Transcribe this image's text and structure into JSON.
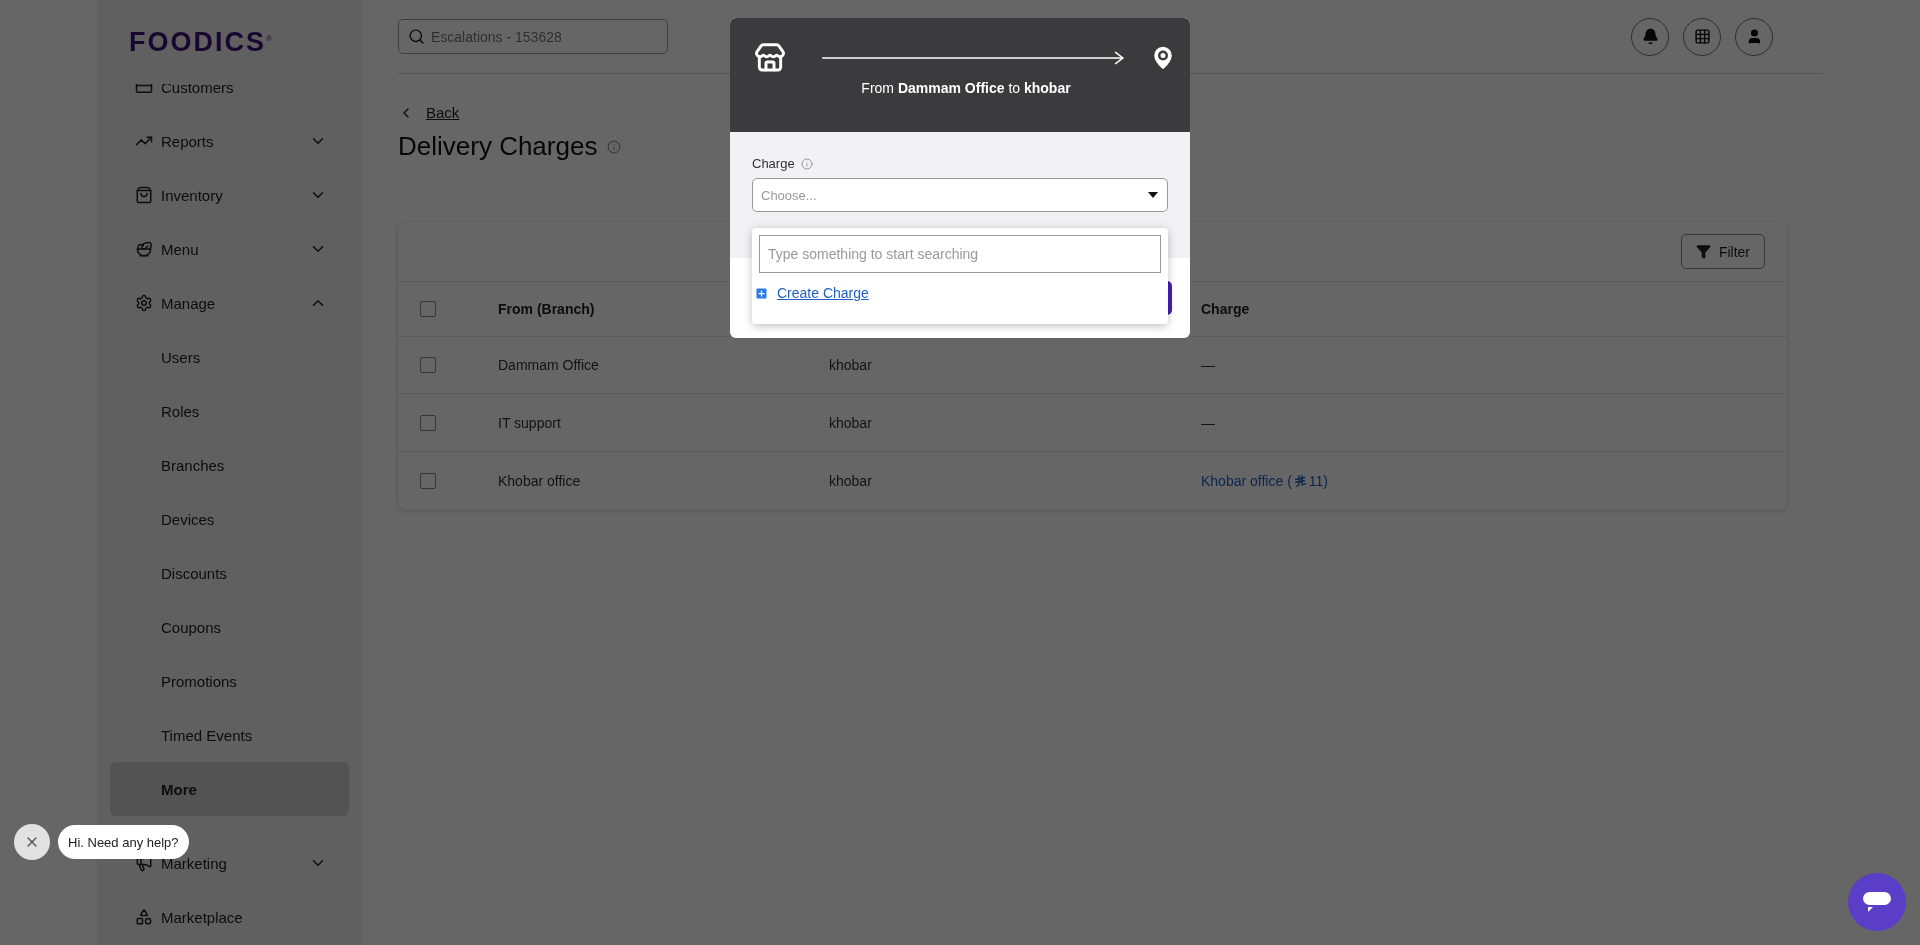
{
  "brand": {
    "logo": "FOODICS$^{®}$"
  },
  "sidebar": {
    "items": [
      {
        "label": "Customers",
        "kind": "link",
        "selected": false
      },
      {
        "label": "Reports",
        "kind": "group",
        "expanded": false
      },
      {
        "label": "Inventory",
        "kind": "group",
        "expanded": false
      },
      {
        "label": "Menu",
        "kind": "group",
        "expanded": false
      },
      {
        "label": "Manage",
        "kind": "group",
        "expanded": true,
        "children": [
          {
            "label": "Users",
            "selected": false
          },
          {
            "label": "Roles",
            "selected": false
          },
          {
            "label": "Branches",
            "selected": false
          },
          {
            "label": "Devices",
            "selected": false
          },
          {
            "label": "Discounts",
            "selected": false
          },
          {
            "label": "Coupons",
            "selected": false
          },
          {
            "label": "Promotions",
            "selected": false
          },
          {
            "label": "Timed Events",
            "selected": false
          },
          {
            "label": "More",
            "selected": true
          }
        ]
      },
      {
        "label": "Marketing",
        "kind": "group",
        "expanded": false
      },
      {
        "label": "Marketplace",
        "kind": "link",
        "selected": false
      }
    ]
  },
  "header": {
    "search": {
      "placeholder": "Escalations - 153628"
    }
  },
  "page": {
    "back": "Back",
    "title": "Delivery Charges",
    "filter": "Filter",
    "table": {
      "columns": [
        "From (Branch)",
        "Charge"
      ],
      "all_checked": false,
      "rows": [
        {
          "checked": false,
          "from": "Dammam Office",
          "to": "khobar",
          "charge": {
            "kind": "none",
            "text": "—"
          }
        },
        {
          "checked": false,
          "from": "IT support",
          "to": "khobar",
          "charge": {
            "kind": "none",
            "text": "—"
          }
        },
        {
          "checked": false,
          "from": "Khobar office",
          "to": "khobar",
          "charge": {
            "kind": "money",
            "text": "Khobar office (",
            "amount": "11)"
          }
        }
      ]
    }
  },
  "modal": {
    "route": "From **Dammam Office** to **khobar**",
    "charge_field": {
      "label": "Charge",
      "placeholder": "Choose...",
      "expanded": true,
      "dropdown": {
        "search_placeholder": "Type something to start searching",
        "action": "Create Charge"
      }
    }
  },
  "chat": {
    "greeting": "Hi. Need any help?"
  }
}
